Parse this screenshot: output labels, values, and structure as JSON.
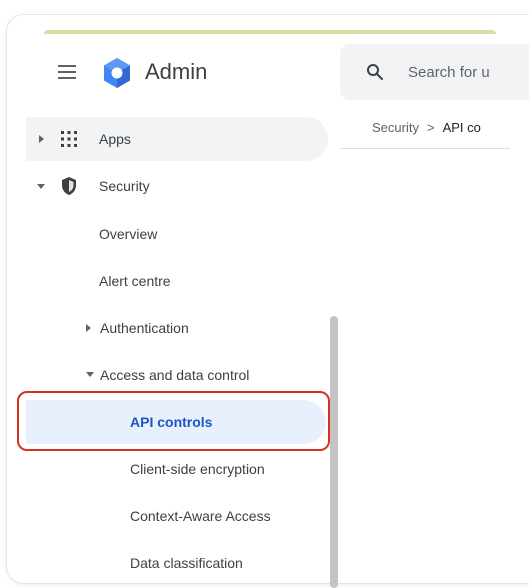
{
  "header": {
    "app_title": "Admin",
    "search_placeholder": "Search for u"
  },
  "breadcrumb": {
    "parent": "Security",
    "separator": ">",
    "current": "API co"
  },
  "sidebar": {
    "items": [
      {
        "label": "Apps"
      },
      {
        "label": "Security"
      },
      {
        "label": "Overview"
      },
      {
        "label": "Alert centre"
      },
      {
        "label": "Authentication"
      },
      {
        "label": "Access and data control"
      },
      {
        "label": "API controls"
      },
      {
        "label": "Client-side encryption"
      },
      {
        "label": "Context-Aware Access"
      },
      {
        "label": "Data classification"
      }
    ]
  },
  "colors": {
    "accent": "#1a56c4",
    "selected_bg": "#e8f0fe",
    "highlight_border": "#d93025",
    "logo_blue": "#4285f4"
  }
}
